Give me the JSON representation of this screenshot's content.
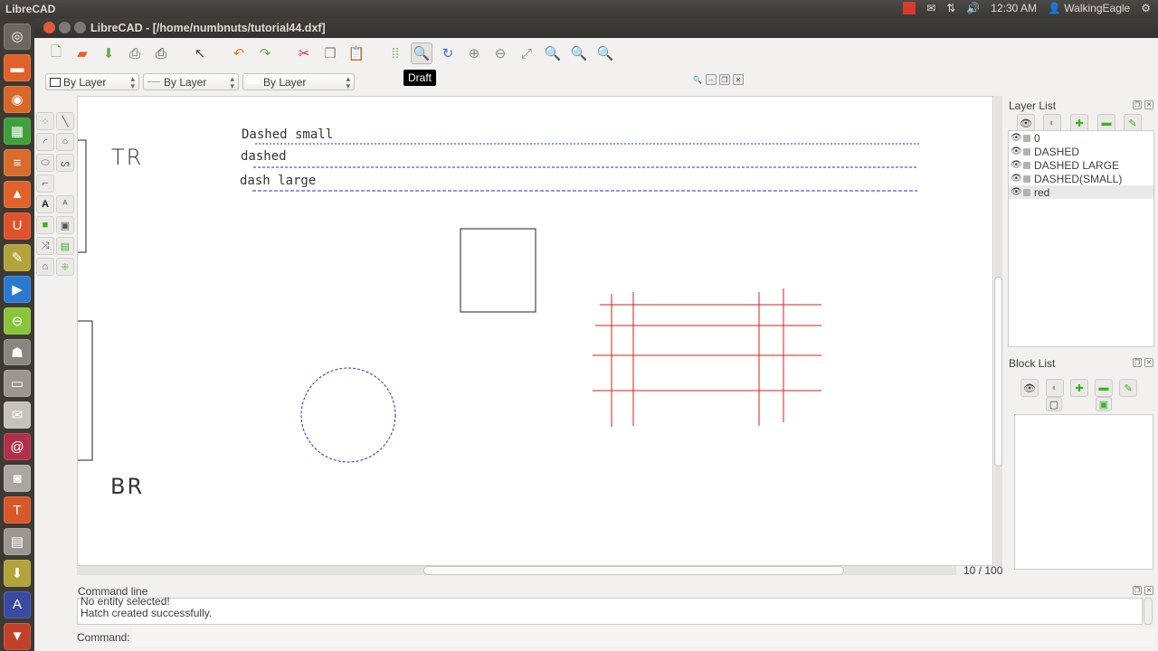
{
  "topbar": {
    "app_name": "LibreCAD",
    "clock": "12:30 AM",
    "user": "WalkingEagle",
    "indicators": [
      "record-indicator",
      "mail-icon",
      "network-icon",
      "volume-icon"
    ]
  },
  "launcher": {
    "items": [
      {
        "name": "dash-home",
        "glyph": "◎",
        "color": "#6b6862"
      },
      {
        "name": "files",
        "glyph": "▬",
        "color": "#e0622a"
      },
      {
        "name": "firefox",
        "glyph": "◉",
        "color": "#d8672a"
      },
      {
        "name": "libreoffice-calc",
        "glyph": "▦",
        "color": "#3f9f3a"
      },
      {
        "name": "libreoffice-writer",
        "glyph": "≡",
        "color": "#d96b2c"
      },
      {
        "name": "software-center",
        "glyph": "▲",
        "color": "#e0622a"
      },
      {
        "name": "ubuntu-one",
        "glyph": "U",
        "color": "#e0522a"
      },
      {
        "name": "librecad",
        "glyph": "✎",
        "color": "#b2a43a"
      },
      {
        "name": "media-player",
        "glyph": "▶",
        "color": "#2a7ad0"
      },
      {
        "name": "gparted",
        "glyph": "⊖",
        "color": "#8ac43a"
      },
      {
        "name": "gimp",
        "glyph": "☗",
        "color": "#8a8780"
      },
      {
        "name": "scanner",
        "glyph": "▭",
        "color": "#9a9790"
      },
      {
        "name": "mail-client",
        "glyph": "✉",
        "color": "#c5c2bd"
      },
      {
        "name": "shutter",
        "glyph": "@",
        "color": "#b0304a"
      },
      {
        "name": "camera",
        "glyph": "◙",
        "color": "#aaa7a0"
      },
      {
        "name": "system-tool",
        "glyph": "T",
        "color": "#d8582a"
      },
      {
        "name": "video-editor",
        "glyph": "▤",
        "color": "#9a9790"
      },
      {
        "name": "installer",
        "glyph": "⬇",
        "color": "#b2a43a"
      },
      {
        "name": "workspaces",
        "glyph": "A",
        "color": "#3a4aa0"
      },
      {
        "name": "trash",
        "glyph": "▼",
        "color": "#c0402a"
      }
    ]
  },
  "window": {
    "title": "LibreCAD - [/home/numbnuts/tutorial44.dxf]"
  },
  "toolbar": {
    "buttons": [
      {
        "name": "new-file",
        "glyph": "🗋",
        "color": "#6aa84f"
      },
      {
        "name": "open-file",
        "glyph": "▰",
        "color": "#e0622a"
      },
      {
        "name": "save-file",
        "glyph": "⬇",
        "color": "#6aa84f"
      },
      {
        "name": "print",
        "glyph": "⎙",
        "color": "#555"
      },
      {
        "name": "print-preview",
        "glyph": "⎙",
        "color": "#333"
      },
      {
        "name": "sep1"
      },
      {
        "name": "select-pointer",
        "glyph": "↖",
        "color": "#444"
      },
      {
        "name": "sep2"
      },
      {
        "name": "undo",
        "glyph": "↶",
        "color": "#e07b2a"
      },
      {
        "name": "redo",
        "glyph": "↷",
        "color": "#6aa84f"
      },
      {
        "name": "sep3"
      },
      {
        "name": "cut",
        "glyph": "✂",
        "color": "#c0303a"
      },
      {
        "name": "copy",
        "glyph": "❐",
        "color": "#888"
      },
      {
        "name": "paste",
        "glyph": "📋",
        "color": "#a88a4a"
      },
      {
        "name": "sep4"
      },
      {
        "name": "grid",
        "glyph": "⁞⁞",
        "color": "#6aa84f"
      },
      {
        "name": "draft",
        "glyph": "🔍",
        "color": "#333",
        "active": true
      },
      {
        "name": "redraw",
        "glyph": "↻",
        "color": "#3a7ad0"
      },
      {
        "name": "zoom-in",
        "glyph": "⊕",
        "color": "#888"
      },
      {
        "name": "zoom-out",
        "glyph": "⊖",
        "color": "#888"
      },
      {
        "name": "zoom-auto",
        "glyph": "⤢",
        "color": "#888"
      },
      {
        "name": "zoom-previous",
        "glyph": "🔍",
        "color": "#4a8a3a"
      },
      {
        "name": "zoom-window",
        "glyph": "🔍",
        "color": "#5ab02a"
      },
      {
        "name": "zoom-pan",
        "glyph": "🔍",
        "color": "#3a8a3a"
      }
    ],
    "tooltip": "Draft"
  },
  "pen": {
    "color": "By Layer",
    "linetype": "By Layer",
    "linewidth": "By Layer"
  },
  "canvas": {
    "texts": {
      "tr": "TR",
      "br": "BR",
      "dashed_small": "Dashed small",
      "dashed": "dashed",
      "dash_large": "dash large"
    },
    "colors": {
      "dashed_lines": "#2a2ad0",
      "red_layer": "#d02020",
      "black": "#222222"
    }
  },
  "status": {
    "grid_info": "10 / 100"
  },
  "layer_panel": {
    "title": "Layer List",
    "layers": [
      {
        "name": "0",
        "selected": false
      },
      {
        "name": "DASHED",
        "selected": false
      },
      {
        "name": "DASHED LARGE",
        "selected": false
      },
      {
        "name": "DASHED(SMALL)",
        "selected": false
      },
      {
        "name": "red",
        "selected": true
      }
    ]
  },
  "block_panel": {
    "title": "Block List"
  },
  "command": {
    "title": "Command line",
    "history": [
      "No entity selected!",
      "Hatch created successfully."
    ],
    "label": "Command:",
    "value": ""
  }
}
